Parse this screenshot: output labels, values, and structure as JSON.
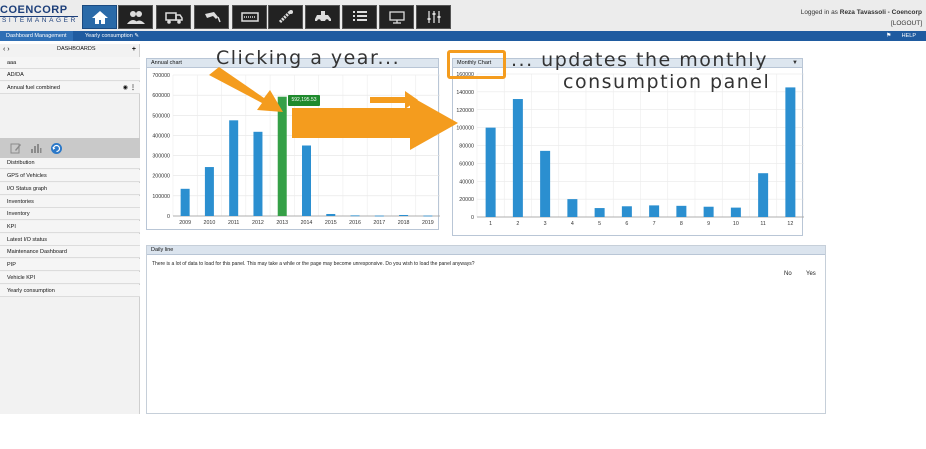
{
  "header": {
    "logo_top": "COENCORP",
    "logo_bottom": "SITEMANAGER",
    "logged_in_prefix": "Logged in as ",
    "user": "Reza Tavassoli - Coencorp",
    "logout": "[LOGOUT]",
    "nav_icons": [
      "home-icon",
      "users-icon",
      "truck-icon",
      "fuel-nozzle-icon",
      "card-reader-icon",
      "drill-icon",
      "car-service-icon",
      "list-icon",
      "device-icon",
      "sliders-icon"
    ]
  },
  "tabs": {
    "dashboard_management": "Dashboard Management",
    "yearly_consumption": "Yearly consumption",
    "help": "HELP"
  },
  "sidebar": {
    "header_title": "DASHBOARDS",
    "items": [
      {
        "label": "aaa"
      },
      {
        "label": "AD/DA"
      },
      {
        "label": "Annual fuel combined"
      },
      {
        "label": "Distribution"
      },
      {
        "label": "GPS of Vehicles"
      },
      {
        "label": "I/O Status graph"
      },
      {
        "label": "Inventories"
      },
      {
        "label": "Inventory"
      },
      {
        "label": "KPI"
      },
      {
        "label": "Latest I/O status"
      },
      {
        "label": "Maintenance Dashboard"
      },
      {
        "label": "PIP"
      },
      {
        "label": "Vehicle KPI"
      },
      {
        "label": "Yearly consumption"
      }
    ]
  },
  "annual_panel_title": "Annual chart",
  "monthly_panel_title": "Monthly Chart",
  "daily_panel": {
    "title": "Daily line",
    "message": "There is a lot of data to load for this panel. This may take a while or the page may become unresponsive. Do you wish to load the panel anyways?",
    "no": "No",
    "yes": "Yes"
  },
  "tooltip": "592,195.53",
  "annotations": {
    "left": "Clicking a year...",
    "right_line1": "... updates the monthly",
    "right_line2": "consumption panel"
  },
  "colors": {
    "bar": "#2b8fd0",
    "bar_selected": "#35a047",
    "arrow": "#f49c1e",
    "header_blue": "#1f5ba0"
  },
  "chart_data": [
    {
      "type": "bar",
      "title": "Annual chart",
      "categories": [
        "2009",
        "2010",
        "2011",
        "2012",
        "2013",
        "2014",
        "2015",
        "2016",
        "2017",
        "2018",
        "2019"
      ],
      "values": [
        135000,
        243000,
        475000,
        418000,
        592195.53,
        350000,
        10000,
        3000,
        2000,
        5000,
        2000
      ],
      "selected": "2013",
      "ylim": [
        0,
        700000
      ],
      "yticks": [
        0,
        100000,
        200000,
        300000,
        400000,
        500000,
        600000,
        700000
      ],
      "grid": true
    },
    {
      "type": "bar",
      "title": "Monthly Chart",
      "categories": [
        "1",
        "2",
        "3",
        "4",
        "5",
        "6",
        "7",
        "8",
        "9",
        "10",
        "11",
        "12"
      ],
      "values": [
        100000,
        132000,
        74000,
        20000,
        10000,
        12000,
        13000,
        12500,
        11500,
        10500,
        49000,
        145000
      ],
      "ylim": [
        0,
        160000
      ],
      "yticks": [
        0,
        20000,
        40000,
        60000,
        80000,
        100000,
        120000,
        140000,
        160000
      ],
      "grid": true
    }
  ]
}
